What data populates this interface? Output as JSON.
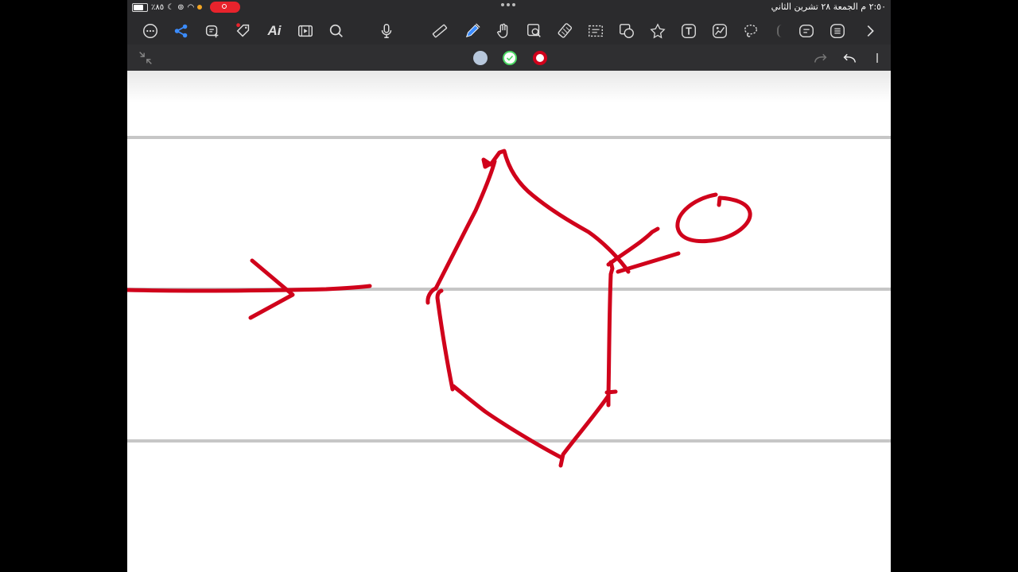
{
  "status_bar": {
    "battery_text": "٪٨٥",
    "date_time": "٢:٥٠ م   الجمعة ٢٨ تشرين الثاني"
  },
  "toolbar": {
    "left_tools": [
      "more-icon",
      "share-icon",
      "add-note-icon",
      "tag-icon",
      "ai-icon",
      "media-icon",
      "search-icon",
      "microphone-icon"
    ],
    "ai_label": "Ai",
    "right_tools": [
      "ruler-icon",
      "pen-icon",
      "hand-icon",
      "zoom-icon",
      "eraser-icon",
      "selection-icon",
      "shapes-icon",
      "star-shape-icon",
      "text-icon",
      "image-icon",
      "lasso-icon",
      "comment-icon",
      "list-icon",
      "chevron-right-icon"
    ]
  },
  "subbar": {
    "swatch_colors": [
      "#b8c8dc",
      "#ffffff",
      "#d0021b"
    ],
    "selected_swatch_ring": "#4cd964"
  },
  "canvas": {
    "ink_color": "#d0021b",
    "rule_color": "#c6c6c6"
  }
}
